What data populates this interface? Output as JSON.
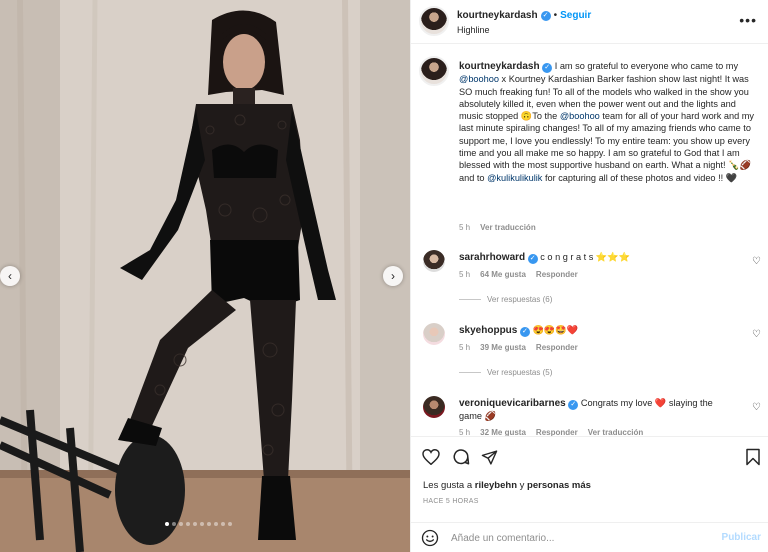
{
  "post_header": {
    "username": "kourtneykardash",
    "follow_label": "Seguir",
    "separator": "•",
    "subtitle": "Highline",
    "more_icon": "more-horizontal-icon"
  },
  "photo": {
    "prev_icon": "chevron-left-icon",
    "next_icon": "chevron-right-icon",
    "slide_count": 10,
    "active_slide": 1
  },
  "caption": {
    "username": "kourtneykardash",
    "part1": " I am so grateful to everyone who came to my ",
    "mention1": "@boohoo",
    "part2": " x Kourtney Kardashian Barker fashion show last night! It was SO much freaking fun! To all of the models who walked in the show you absolutely killed it, even when the power went out and the lights and music stopped 🙃To the ",
    "mention2": "@boohoo",
    "part3": " team for all of your hard work and my last minute spiraling changes! To all of my amazing friends who came to support me, I love you endlessly! To my entire team: you show up every time and you all make me so happy. I am so grateful to God that I am blessed with the most supportive husband on earth. What a night! 🍾🏈 and to ",
    "mention3": "@kulikulikulik",
    "part4": " for capturing all of these photos and video !! 🖤",
    "time": "5 h",
    "translate": "Ver traducción"
  },
  "comments": [
    {
      "username": "sarahrhoward",
      "text": " c o n g r a t s ⭐⭐⭐",
      "time": "5 h",
      "likes": "64 Me gusta",
      "reply": "Responder",
      "replies_label": "Ver respuestas (6)"
    },
    {
      "username": "skyehoppus",
      "text": " 😍😍🤩❤️",
      "time": "5 h",
      "likes": "39 Me gusta",
      "reply": "Responder",
      "replies_label": "Ver respuestas (5)"
    },
    {
      "username": "veroniquevicaribarnes",
      "text": " Congrats my love ❤️ slaying the game 🏈",
      "time": "5 h",
      "likes": "32 Me gusta",
      "reply": "Responder",
      "translate": "Ver traducción"
    }
  ],
  "actions": {
    "like_icon": "heart-icon",
    "comment_icon": "comment-icon",
    "share_icon": "send-icon",
    "save_icon": "bookmark-icon"
  },
  "likes": {
    "prefix": "Les gusta a ",
    "user": "rileybehn",
    "middle": " y ",
    "others": "personas más"
  },
  "time_ago": "HACE 5 HORAS",
  "composer": {
    "placeholder": "Añade un comentario...",
    "publish_label": "Publicar",
    "emoji_icon": "emoji-icon"
  }
}
